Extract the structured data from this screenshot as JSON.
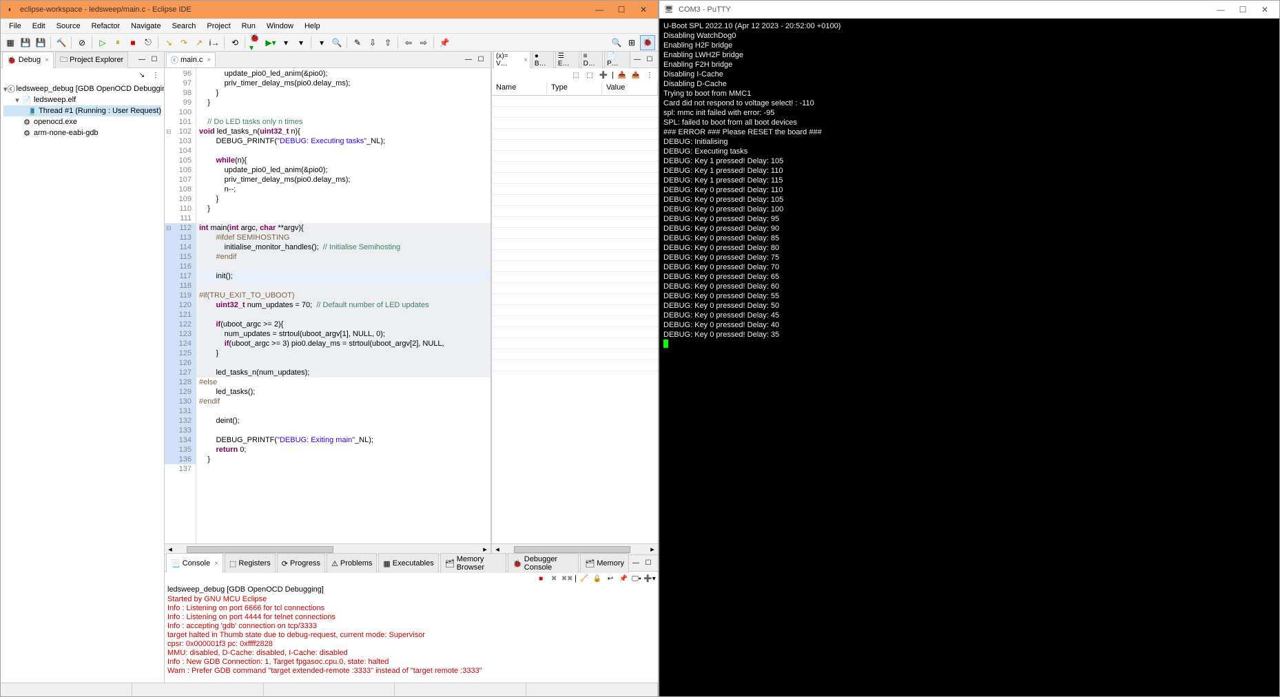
{
  "eclipse": {
    "title": "eclipse-workspace - ledsweep/main.c - Eclipse IDE",
    "menu": [
      "File",
      "Edit",
      "Source",
      "Refactor",
      "Navigate",
      "Search",
      "Project",
      "Run",
      "Window",
      "Help"
    ],
    "left": {
      "tabs": [
        {
          "label": "Debug",
          "icon": "🐞"
        },
        {
          "label": "Project Explorer",
          "icon": "📁"
        }
      ],
      "tree": [
        {
          "depth": 0,
          "toggle": "▾",
          "icon": "ⓒ",
          "label": "ledsweep_debug [GDB OpenOCD Debugging]",
          "sel": false
        },
        {
          "depth": 1,
          "toggle": "▾",
          "icon": "📄",
          "label": "ledsweep.elf",
          "sel": false
        },
        {
          "depth": 2,
          "toggle": "",
          "icon": "🧵",
          "label": "Thread #1 (Running : User Request)",
          "sel": true
        },
        {
          "depth": 1,
          "toggle": "",
          "icon": "⚙",
          "label": "openocd.exe",
          "sel": false
        },
        {
          "depth": 1,
          "toggle": "",
          "icon": "⚙",
          "label": "arm-none-eabi-gdb",
          "sel": false
        }
      ]
    },
    "editor": {
      "tab": "main.c",
      "lines": [
        {
          "n": 96,
          "html": "            update_pio0_led_anim(&pio0);"
        },
        {
          "n": 97,
          "html": "            priv_timer_delay_ms(pio0.delay_ms);"
        },
        {
          "n": 98,
          "html": "        }"
        },
        {
          "n": 99,
          "html": "    }"
        },
        {
          "n": 100,
          "html": ""
        },
        {
          "n": 101,
          "html": "    <span class='cm'>// Do LED tasks only n times</span>"
        },
        {
          "n": 102,
          "fold": true,
          "html": "<span class='kw'>void</span> <span class='fn'>led_tasks_n</span>(<span class='kw'>uint32_t</span> n){"
        },
        {
          "n": 103,
          "html": "        DEBUG_PRINTF(<span class='st'>\"DEBUG: Executing tasks\"</span>_NL);"
        },
        {
          "n": 104,
          "html": ""
        },
        {
          "n": 105,
          "html": "        <span class='kw'>while</span>(n){"
        },
        {
          "n": 106,
          "html": "            update_pio0_led_anim(&pio0);"
        },
        {
          "n": 107,
          "html": "            priv_timer_delay_ms(pio0.delay_ms);"
        },
        {
          "n": 108,
          "html": "            n--;"
        },
        {
          "n": 109,
          "html": "        }"
        },
        {
          "n": 110,
          "html": "    }"
        },
        {
          "n": 111,
          "html": ""
        },
        {
          "n": 112,
          "fold": true,
          "marked": true,
          "shaded": true,
          "html": "<span class='kw'>int</span> <span class='fn'>main</span>(<span class='kw'>int</span> argc, <span class='kw'>char</span> **argv){"
        },
        {
          "n": 113,
          "marked": true,
          "shaded": true,
          "html": "        <span class='pp'>#ifdef SEMIHOSTING</span>"
        },
        {
          "n": 114,
          "marked": true,
          "shaded": true,
          "html": "            initialise_monitor_handles();  <span class='cm'>// Initialise Semihosting</span>"
        },
        {
          "n": 115,
          "marked": true,
          "shaded": true,
          "html": "        <span class='pp'>#endif</span>"
        },
        {
          "n": 116,
          "marked": true,
          "shaded": true,
          "html": ""
        },
        {
          "n": 117,
          "marked": true,
          "current": true,
          "html": "        init();"
        },
        {
          "n": 118,
          "marked": true,
          "shaded": true,
          "html": ""
        },
        {
          "n": 119,
          "marked": true,
          "shaded": true,
          "html": "<span class='pp'>#if(TRU_EXIT_TO_UBOOT)</span>"
        },
        {
          "n": 120,
          "marked": true,
          "shaded": true,
          "html": "        <span class='kw'>uint32_t</span> num_updates = 70;  <span class='cm'>// Default number of LED updates</span>"
        },
        {
          "n": 121,
          "marked": true,
          "shaded": true,
          "html": ""
        },
        {
          "n": 122,
          "marked": true,
          "shaded": true,
          "html": "        <span class='kw'>if</span>(uboot_argc >= 2){"
        },
        {
          "n": 123,
          "marked": true,
          "shaded": true,
          "html": "            num_updates = strtoul(uboot_argv[1], NULL, 0);"
        },
        {
          "n": 124,
          "marked": true,
          "shaded": true,
          "html": "            <span class='kw'>if</span>(uboot_argc >= 3) pio0.delay_ms = strtoul(uboot_argv[2], NULL,"
        },
        {
          "n": 125,
          "marked": true,
          "shaded": true,
          "html": "        }"
        },
        {
          "n": 126,
          "marked": true,
          "shaded": true,
          "html": ""
        },
        {
          "n": 127,
          "marked": true,
          "shaded": true,
          "html": "        led_tasks_n(num_updates);"
        },
        {
          "n": 128,
          "marked": true,
          "html": "<span class='pp'>#else</span>"
        },
        {
          "n": 129,
          "marked": true,
          "html": "        led_tasks();"
        },
        {
          "n": 130,
          "marked": true,
          "html": "<span class='pp'>#endif</span>"
        },
        {
          "n": 131,
          "marked": true,
          "html": ""
        },
        {
          "n": 132,
          "marked": true,
          "html": "        deint();"
        },
        {
          "n": 133,
          "marked": true,
          "html": ""
        },
        {
          "n": 134,
          "marked": true,
          "html": "        DEBUG_PRINTF(<span class='st'>\"DEBUG: Exiting main\"</span>_NL);"
        },
        {
          "n": 135,
          "marked": true,
          "html": "        <span class='kw'>return</span> 0;"
        },
        {
          "n": 136,
          "marked": true,
          "html": "    }"
        },
        {
          "n": 137,
          "html": ""
        }
      ]
    },
    "right": {
      "tabs": [
        "(x)= V…",
        "● B…",
        "☰ E…",
        "≡ D…",
        "📄 P…"
      ],
      "cols": [
        "Name",
        "Type",
        "Value"
      ]
    },
    "bottom": {
      "tabs": [
        "Console",
        "Registers",
        "Progress",
        "Problems",
        "Executables",
        "Memory Browser",
        "Debugger Console",
        "Memory"
      ],
      "title": "ledsweep_debug [GDB OpenOCD Debugging]",
      "lines": [
        "Started by GNU MCU Eclipse",
        "Info : Listening on port 6666 for tcl connections",
        "Info : Listening on port 4444 for telnet connections",
        "Info : accepting 'gdb' connection on tcp/3333",
        "target halted in Thumb state due to debug-request, current mode: Supervisor",
        "cpsr: 0x000001f3 pc: 0xffff2828",
        "MMU: disabled, D-Cache: disabled, I-Cache: disabled",
        "Info : New GDB Connection: 1, Target fpgasoc.cpu.0, state: halted",
        "Warn : Prefer GDB command \"target extended-remote :3333\" instead of \"target remote :3333\""
      ]
    }
  },
  "putty": {
    "title": "COM3 - PuTTY",
    "lines": [
      "U-Boot SPL 2022.10 (Apr 12 2023 - 20:52:00 +0100)",
      "Disabling WatchDog0",
      "Enabling H2F bridge",
      "Enabling LWH2F bridge",
      "Enabling F2H bridge",
      "Disabling I-Cache",
      "Disabling D-Cache",
      "Trying to boot from MMC1",
      "Card did not respond to voltage select! : -110",
      "spl: mmc init failed with error: -95",
      "SPL: failed to boot from all boot devices",
      "### ERROR ### Please RESET the board ###",
      "DEBUG: Initialising",
      "DEBUG: Executing tasks",
      "DEBUG: Key 1 pressed! Delay: 105",
      "DEBUG: Key 1 pressed! Delay: 110",
      "DEBUG: Key 1 pressed! Delay: 115",
      "DEBUG: Key 0 pressed! Delay: 110",
      "DEBUG: Key 0 pressed! Delay: 105",
      "DEBUG: Key 0 pressed! Delay: 100",
      "DEBUG: Key 0 pressed! Delay: 95",
      "DEBUG: Key 0 pressed! Delay: 90",
      "DEBUG: Key 0 pressed! Delay: 85",
      "DEBUG: Key 0 pressed! Delay: 80",
      "DEBUG: Key 0 pressed! Delay: 75",
      "DEBUG: Key 0 pressed! Delay: 70",
      "DEBUG: Key 0 pressed! Delay: 65",
      "DEBUG: Key 0 pressed! Delay: 60",
      "DEBUG: Key 0 pressed! Delay: 55",
      "DEBUG: Key 0 pressed! Delay: 50",
      "DEBUG: Key 0 pressed! Delay: 45",
      "DEBUG: Key 0 pressed! Delay: 40",
      "DEBUG: Key 0 pressed! Delay: 35"
    ]
  }
}
